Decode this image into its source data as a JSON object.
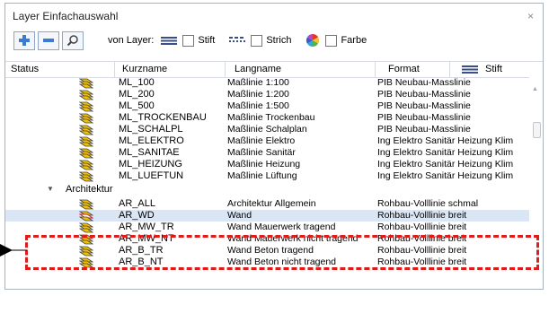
{
  "window": {
    "title": "Layer Einfachauswahl",
    "close": "×"
  },
  "toolbar": {
    "von_layer": "von Layer:",
    "options": [
      {
        "label": "Stift",
        "checked": false
      },
      {
        "label": "Strich",
        "checked": false
      },
      {
        "label": "Farbe",
        "checked": false
      }
    ]
  },
  "columns": {
    "status": "Status",
    "kurzname": "Kurzname",
    "langname": "Langname",
    "format": "Format",
    "stift": "Stift"
  },
  "rows_top": [
    {
      "k": "ML_100",
      "l": "Maßlinie 1:100",
      "f": "PIB Neubau-Masslinie"
    },
    {
      "k": "ML_200",
      "l": "Maßlinie 1:200",
      "f": "PIB Neubau-Masslinie"
    },
    {
      "k": "ML_500",
      "l": "Maßlinie 1:500",
      "f": "PIB Neubau-Masslinie"
    },
    {
      "k": "ML_TROCKENBAU",
      "l": "Maßlinie Trockenbau",
      "f": "PIB Neubau-Masslinie"
    },
    {
      "k": "ML_SCHALPL",
      "l": "Maßlinie Schalplan",
      "f": "PIB Neubau-Masslinie"
    },
    {
      "k": "ML_ELEKTRO",
      "l": "Maßlinie Elektro",
      "f": "Ing Elektro Sanitär Heizung Klim"
    },
    {
      "k": "ML_SANITAE",
      "l": "Maßlinie Sanitär",
      "f": "Ing Elektro Sanitär Heizung Klim"
    },
    {
      "k": "ML_HEIZUNG",
      "l": "Maßlinie Heizung",
      "f": "Ing Elektro Sanitär Heizung Klim"
    },
    {
      "k": "ML_LUEFTUN",
      "l": "Maßlinie Lüftung",
      "f": "Ing Elektro Sanitär Heizung Klim"
    }
  ],
  "group": {
    "label": "Architektur"
  },
  "rows_bottom": [
    {
      "k": "AR_ALL",
      "l": "Architektur Allgemein",
      "f": "Rohbau-Volllinie schmal"
    },
    {
      "k": "AR_WD",
      "l": "Wand",
      "f": "Rohbau-Volllinie breit"
    },
    {
      "k": "AR_MW_TR",
      "l": "Wand Mauerwerk tragend",
      "f": "Rohbau-Volllinie breit"
    },
    {
      "k": "AR_MW_NT",
      "l": "Wand Mauerwerk nicht tragend",
      "f": "Rohbau-Volllinie breit"
    },
    {
      "k": "AR_B_TR",
      "l": "Wand Beton tragend",
      "f": "Rohbau-Volllinie breit"
    },
    {
      "k": "AR_B_NT",
      "l": "Wand Beton nicht tragend",
      "f": "Rohbau-Volllinie breit"
    }
  ],
  "colors": {
    "highlight": "#e11a1a",
    "selection": "#dbe6f4"
  }
}
